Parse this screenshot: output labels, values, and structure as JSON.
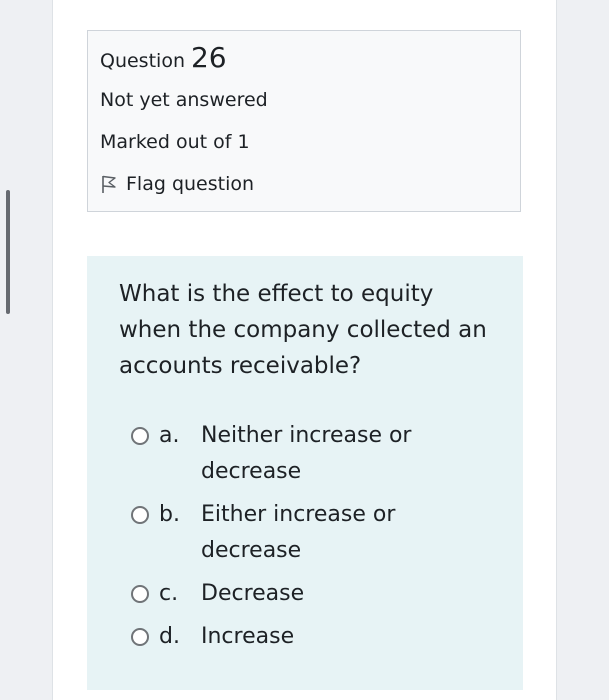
{
  "question_info": {
    "label": "Question",
    "number": "26",
    "state": "Not yet answered",
    "grade": "Marked out of 1",
    "flag_label": "Flag question"
  },
  "question": {
    "text": "What is the effect to equity when the company collected an accounts receivable?",
    "answers": [
      {
        "letter": "a.",
        "text": "Neither increase or decrease",
        "selected": false
      },
      {
        "letter": "b.",
        "text": "Either increase or decrease",
        "selected": false
      },
      {
        "letter": "c.",
        "text": "Decrease",
        "selected": false
      },
      {
        "letter": "d.",
        "text": "Increase",
        "selected": false
      }
    ]
  },
  "colors": {
    "info_background": "#f8f9fa",
    "question_background": "#e7f3f5",
    "text": "#1d2125"
  }
}
